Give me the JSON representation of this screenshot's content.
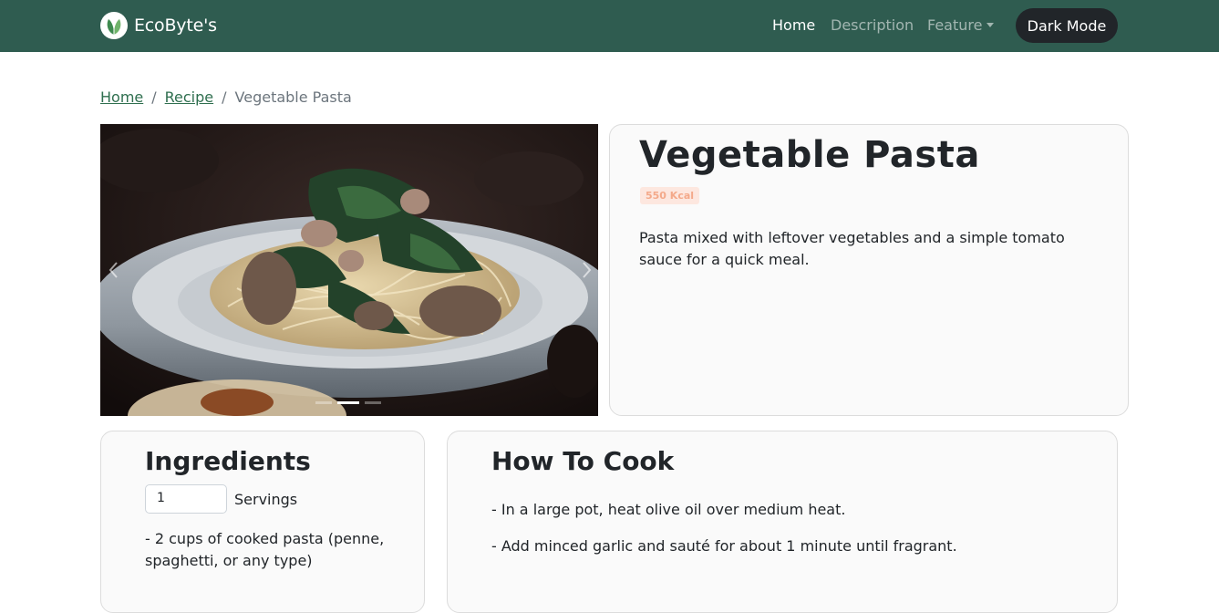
{
  "navbar": {
    "brand": "EcoByte's",
    "links": [
      {
        "label": "Home",
        "active": true
      },
      {
        "label": "Description",
        "active": false
      },
      {
        "label": "Feature",
        "active": false
      }
    ],
    "dark_mode_label": "Dark Mode"
  },
  "breadcrumb": {
    "items": [
      "Home",
      "Recipe"
    ],
    "current": "Vegetable Pasta"
  },
  "carousel": {
    "image": "pasta-dish-photo",
    "slide_count": 3,
    "active_slide": 2
  },
  "recipe": {
    "title": "Vegetable Pasta",
    "kcal": "550 Kcal",
    "description": "Pasta mixed with leftover vegetables and a simple tomato sauce for a quick meal."
  },
  "ingredients": {
    "title": "Ingredients",
    "servings_value": "1",
    "servings_label": "Servings",
    "items": [
      "- 2 cups of cooked pasta (penne, spaghetti, or any type)"
    ]
  },
  "how_to_cook": {
    "title": "How To Cook",
    "steps": [
      "- In a large pot, heat olive oil over medium heat.",
      "- Add minced garlic and sauté for about 1 minute until fragrant."
    ]
  },
  "colors": {
    "navbar_bg": "#2f5c50",
    "link_green": "#2f6f4f",
    "badge_bg": "#fde7df",
    "badge_text": "#f4a98a",
    "dark_button": "#212529"
  },
  "icons": {
    "logo": "leaf-logo-icon",
    "dropdown": "caret-down-icon",
    "prev": "chevron-left-icon",
    "next": "chevron-right-icon"
  }
}
